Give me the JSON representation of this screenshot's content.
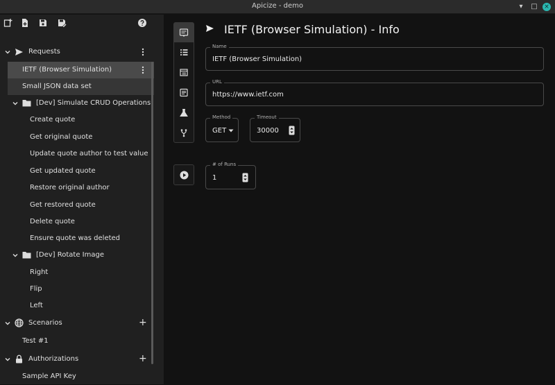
{
  "window": {
    "title": "Apicize - demo",
    "minimize_glyph": "▾",
    "maximize_glyph": "□",
    "close_glyph": "×",
    "close_color": "#2ab7b0"
  },
  "toolbar": {
    "icons": [
      "new-request-icon",
      "new-file-icon",
      "save-icon",
      "save-as-icon",
      "help-icon"
    ]
  },
  "sidebar": {
    "requests_label": "Requests",
    "items": [
      {
        "label": "IETF (Browser Simulation)"
      },
      {
        "label": "Small JSON data set"
      }
    ],
    "group1": {
      "label": "[Dev] Simulate CRUD Operations",
      "items": [
        {
          "label": "Create quote"
        },
        {
          "label": "Get original quote"
        },
        {
          "label": "Update quote author to test value"
        },
        {
          "label": "Get updated quote"
        },
        {
          "label": "Restore original author"
        },
        {
          "label": "Get restored quote"
        },
        {
          "label": "Delete quote"
        },
        {
          "label": "Ensure quote was deleted"
        }
      ]
    },
    "group2": {
      "label": "[Dev] Rotate Image",
      "items": [
        {
          "label": "Right"
        },
        {
          "label": "Flip"
        },
        {
          "label": "Left"
        }
      ]
    },
    "scenarios_label": "Scenarios",
    "scenarios": [
      {
        "label": "Test #1"
      }
    ],
    "authorizations_label": "Authorizations",
    "authorizations": [
      {
        "label": "Sample API Key"
      }
    ],
    "add_glyph": "+"
  },
  "main": {
    "title": "IETF (Browser Simulation) - Info",
    "name_label": "Name",
    "name_value": "IETF (Browser Simulation)",
    "url_label": "URL",
    "url_value": "https://www.ietf.com",
    "method_label": "Method",
    "method_value": "GET",
    "timeout_label": "Timeout",
    "timeout_value": "30000",
    "runs_label": "# of Runs",
    "runs_value": "1",
    "vtabs": [
      "info-icon",
      "query-string-icon",
      "headers-icon",
      "body-icon",
      "test-icon",
      "parameters-icon"
    ],
    "active_vtab": "info-icon"
  }
}
